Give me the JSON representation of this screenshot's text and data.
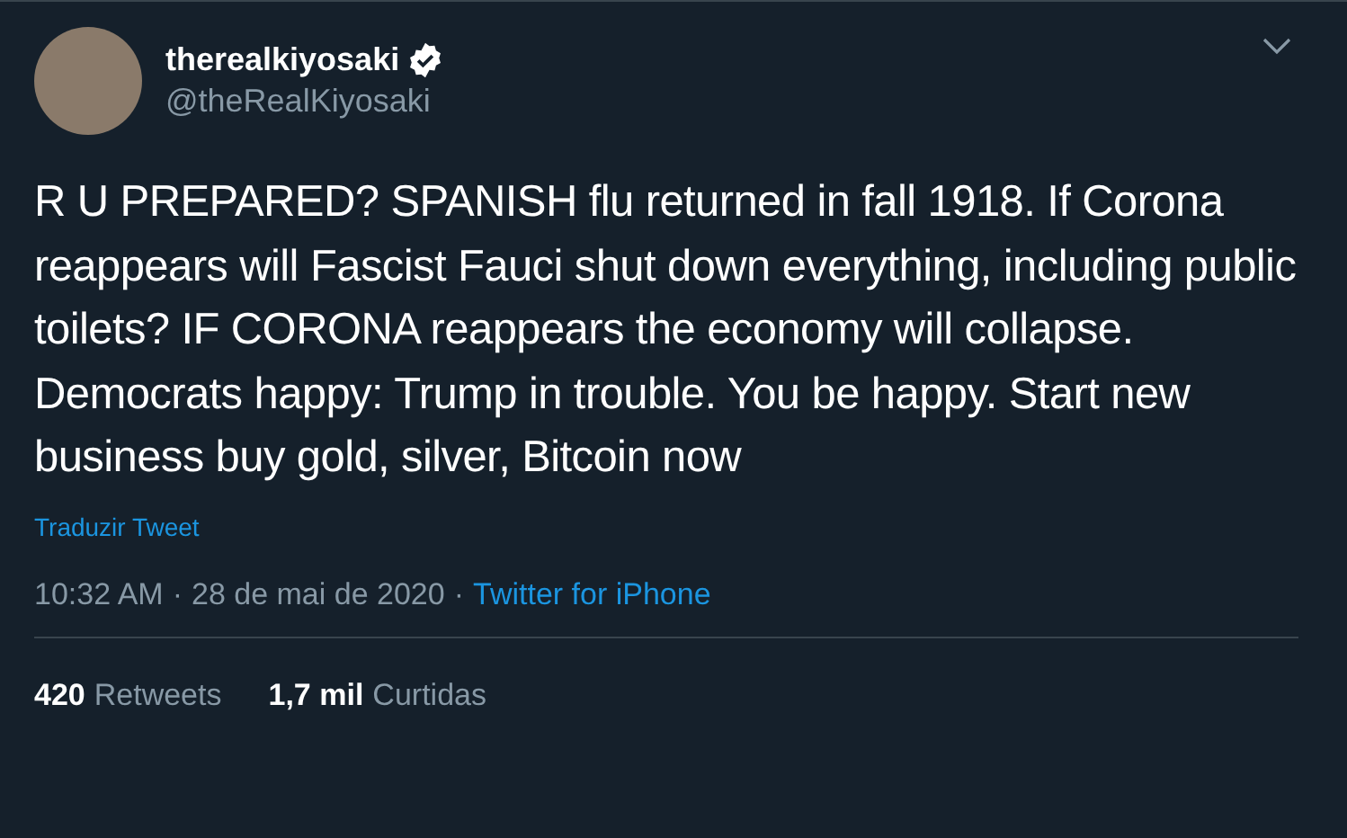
{
  "author": {
    "name": "therealkiyosaki",
    "verified": true,
    "handle": "@theRealKiyosaki"
  },
  "tweet": {
    "text": "R U PREPARED? SPANISH flu returned in fall 1918. If Corona reappears will Fascist Fauci shut down everything, including public toilets? IF CORONA reappears the economy will collapse. Democrats happy: Trump in trouble. You be happy. Start new business buy gold, silver, Bitcoin now",
    "translate_link": "Traduzir Tweet",
    "time": "10:32 AM",
    "separator_1": "·",
    "date": "28 de mai de 2020",
    "separator_2": "·",
    "source": "Twitter for iPhone"
  },
  "stats": [
    {
      "count": "420",
      "label": "Retweets"
    },
    {
      "count": "1,7 mil",
      "label": "Curtidas"
    }
  ]
}
